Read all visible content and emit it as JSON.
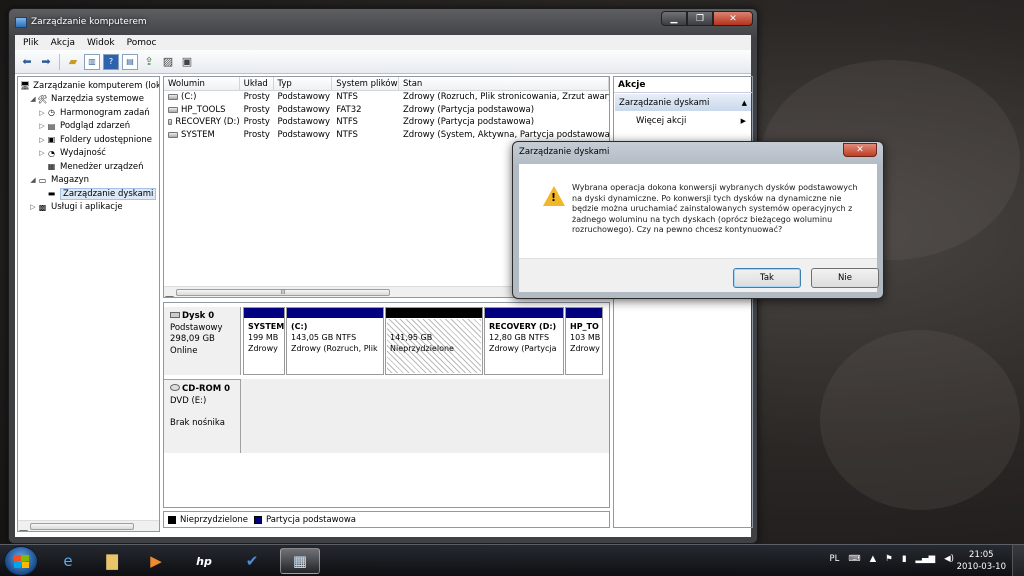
{
  "window": {
    "title": "Zarządzanie komputerem",
    "min": "▁",
    "max": "❐",
    "close": "✕"
  },
  "menu": [
    "Plik",
    "Akcja",
    "Widok",
    "Pomoc"
  ],
  "toolbar_icons": [
    "back-icon",
    "forward-icon",
    "up-folder-icon",
    "show-hide-tree-icon",
    "help-icon",
    "view-icon",
    "export-icon",
    "properties-icon",
    "wizard-icon"
  ],
  "tree": [
    {
      "label": "Zarządzanie komputerem (loka",
      "level": 0,
      "arrow": "",
      "icon": "computer-management-icon",
      "glyph": "🖥"
    },
    {
      "label": "Narzędzia systemowe",
      "level": 1,
      "arrow": "◢",
      "icon": "tools-icon",
      "glyph": "🛠"
    },
    {
      "label": "Harmonogram zadań",
      "level": 2,
      "arrow": "▷",
      "icon": "clock-icon",
      "glyph": "◷"
    },
    {
      "label": "Podgląd zdarzeń",
      "level": 2,
      "arrow": "▷",
      "icon": "event-viewer-icon",
      "glyph": "▤"
    },
    {
      "label": "Foldery udostępnione",
      "level": 2,
      "arrow": "▷",
      "icon": "shared-folder-icon",
      "glyph": "▣"
    },
    {
      "label": "Wydajność",
      "level": 2,
      "arrow": "▷",
      "icon": "performance-icon",
      "glyph": "◔"
    },
    {
      "label": "Menedżer urządzeń",
      "level": 2,
      "arrow": "",
      "icon": "device-manager-icon",
      "glyph": "▦"
    },
    {
      "label": "Magazyn",
      "level": 1,
      "arrow": "◢",
      "icon": "storage-icon",
      "glyph": "▭"
    },
    {
      "label": "Zarządzanie dyskami",
      "level": 2,
      "arrow": "",
      "icon": "disk-management-icon",
      "glyph": "▬",
      "selected": true
    },
    {
      "label": "Usługi i aplikacje",
      "level": 1,
      "arrow": "▷",
      "icon": "services-icon",
      "glyph": "▩"
    }
  ],
  "volumes": {
    "headers": [
      "Wolumin",
      "Układ",
      "Typ",
      "System plików",
      "Stan"
    ],
    "rows": [
      [
        "(C:)",
        "Prosty",
        "Podstawowy",
        "NTFS",
        "Zdrowy (Rozruch, Plik stronicowania, Zrzut awaryjny"
      ],
      [
        "HP_TOOLS",
        "Prosty",
        "Podstawowy",
        "FAT32",
        "Zdrowy (Partycja podstawowa)"
      ],
      [
        "RECOVERY (D:)",
        "Prosty",
        "Podstawowy",
        "NTFS",
        "Zdrowy (Partycja podstawowa)"
      ],
      [
        "SYSTEM",
        "Prosty",
        "Podstawowy",
        "NTFS",
        "Zdrowy (System, Aktywna, Partycja podstawowa)"
      ]
    ],
    "scroll_grip": "III"
  },
  "disks": [
    {
      "name": "Dysk 0",
      "type": "Podstawowy",
      "size": "298,09 GB",
      "status": "Online",
      "partitions": [
        {
          "name": "SYSTEM",
          "size": "199 MB",
          "status": "Zdrowy",
          "color": "#000080",
          "unalloc": false,
          "width": 42
        },
        {
          "name": "(C:)",
          "size": "143,05 GB NTFS",
          "status": "Zdrowy (Rozruch, Plik",
          "color": "#000080",
          "unalloc": false,
          "width": 98
        },
        {
          "name": "",
          "size": "141,95 GB",
          "status": "Nieprzydzielone",
          "color": "#000000",
          "unalloc": true,
          "width": 98
        },
        {
          "name": "RECOVERY  (D:)",
          "size": "12,80 GB NTFS",
          "status": "Zdrowy (Partycja",
          "color": "#000080",
          "unalloc": false,
          "width": 80
        },
        {
          "name": "HP_TO",
          "size": "103 MB",
          "status": "Zdrowy",
          "color": "#000080",
          "unalloc": false,
          "width": 38
        }
      ]
    },
    {
      "name": "CD-ROM 0",
      "type": "DVD (E:)",
      "size": "",
      "status": "Brak nośnika"
    }
  ],
  "legend": [
    {
      "label": "Nieprzydzielone",
      "color": "#000000"
    },
    {
      "label": "Partycja podstawowa",
      "color": "#000080"
    }
  ],
  "actions": {
    "header": "Akcje",
    "section": "Zarządzanie dyskami",
    "section_arrow": "▲",
    "items": [
      {
        "label": "Więcej akcji",
        "arrow": "▶"
      }
    ]
  },
  "dialog": {
    "title": "Zarządzanie dyskami",
    "close": "✕",
    "warn_glyph": "!",
    "message": "Wybrana operacja dokona konwersji wybranych dysków podstawowych na dyski dynamiczne. Po konwersji tych dysków na dynamiczne nie będzie można uruchamiać zainstalowanych systemów operacyjnych z żadnego woluminu na tych dyskach (oprócz bieżącego woluminu rozruchowego). Czy na pewno chcesz kontynuować?",
    "yes": "Tak",
    "no": "Nie"
  },
  "taskbar": {
    "apps": [
      {
        "name": "ie-icon",
        "glyph": "e",
        "color": "#5aa9ec"
      },
      {
        "name": "explorer-icon",
        "glyph": "▇",
        "color": "#e9c46a"
      },
      {
        "name": "media-player-icon",
        "glyph": "▶",
        "color": "#f08c2c"
      },
      {
        "name": "hp-icon",
        "glyph": "hp",
        "color": "#ffffff"
      },
      {
        "name": "checkmark-app-icon",
        "glyph": "✔",
        "color": "#4a90d9"
      },
      {
        "name": "computer-management-task-icon",
        "glyph": "▦",
        "color": "#cfe3f7"
      }
    ],
    "lang": "PL",
    "tray_icons": [
      "keyboard-icon",
      "arrow-up-icon",
      "flag-icon",
      "power-icon",
      "signal-icon",
      "volume-icon"
    ],
    "time": "21:05",
    "date": "2010-03-10"
  }
}
